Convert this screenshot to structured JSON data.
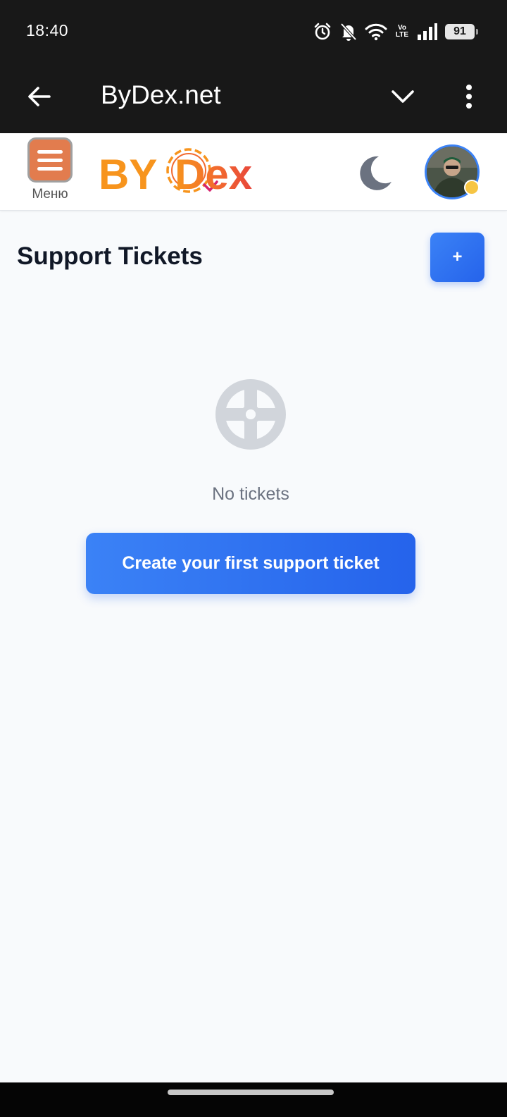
{
  "status_bar": {
    "time": "18:40",
    "volte_top": "Vo",
    "volte_bottom": "LTE",
    "battery": "91",
    "icons": [
      "alarm-icon",
      "bell-off-icon",
      "wifi-icon",
      "volte-icon",
      "signal-icon",
      "battery-icon"
    ]
  },
  "app_bar": {
    "title": "ByDex.net",
    "icons": [
      "back-arrow-icon",
      "chevron-down-icon",
      "more-vert-icon"
    ]
  },
  "site_header": {
    "menu_label": "Меню",
    "logo_text": "BYDex",
    "logo_colors": {
      "orange": "#f39c12",
      "red": "#e74c3c",
      "magenta": "#d6246e"
    }
  },
  "main": {
    "title": "Support Tickets",
    "add_button_label": "+",
    "empty_icon": "lifebuoy-icon",
    "empty_text": "No tickets",
    "cta_label": "Create your first support ticket"
  },
  "colors": {
    "accent": "#3b82f6",
    "accent_dark": "#2563eb",
    "page_bg": "#f8fafc",
    "chrome": "#181818",
    "menu_button": "#e27c4e"
  }
}
